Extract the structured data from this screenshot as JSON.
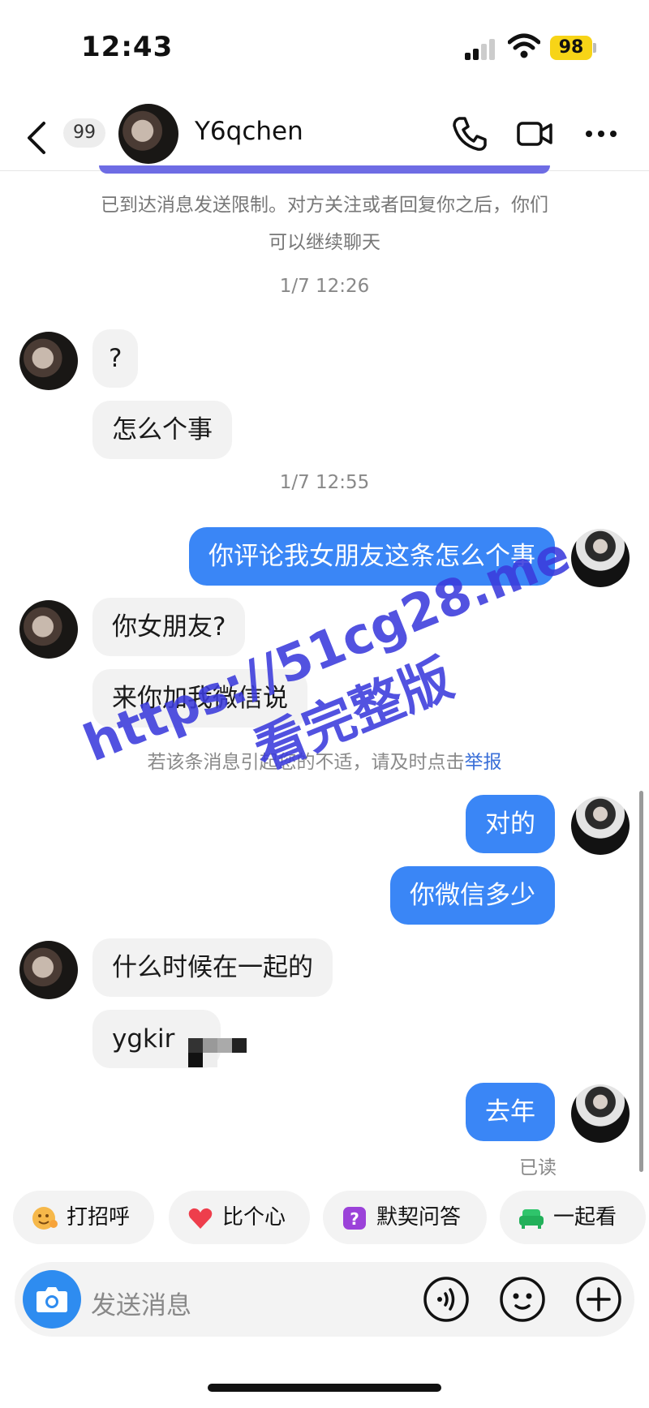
{
  "status_bar": {
    "time": "12:43",
    "battery": "98"
  },
  "header": {
    "unread_count": "99",
    "contact_name": "Y6qchen"
  },
  "notice": {
    "line1": "已到达消息发送限制。对方关注或者回复你之后，你们",
    "line2": "可以继续聊天"
  },
  "messages": {
    "ts1": "1/7 12:26",
    "m1": "?",
    "m2": "怎么个事",
    "ts2": "1/7 12:55",
    "m3": "你评论我女朋友这条怎么个事",
    "m4": "你女朋友?",
    "m5": "来你加我微信说",
    "warning_prefix": "若该条消息引起您的不适，请及时点击",
    "warning_link": "举报",
    "m6": "对的",
    "m7": "你微信多少",
    "m8": "什么时候在一起的",
    "m9": "ygkir",
    "m10": "去年",
    "read_status": "已读"
  },
  "quick_actions": [
    {
      "label": "打招呼",
      "icon": "wave-emoji-icon"
    },
    {
      "label": "比个心",
      "icon": "heart-icon"
    },
    {
      "label": "默契问答",
      "icon": "question-icon"
    },
    {
      "label": "一起看",
      "icon": "sofa-icon"
    }
  ],
  "composer": {
    "placeholder": "发送消息"
  },
  "watermark": {
    "line1": "https://51cg28.me",
    "line2": "看完整版"
  },
  "colors": {
    "accent": "#3a86f6",
    "limit_bar": "#6e6ce4",
    "battery": "#f7d417"
  }
}
